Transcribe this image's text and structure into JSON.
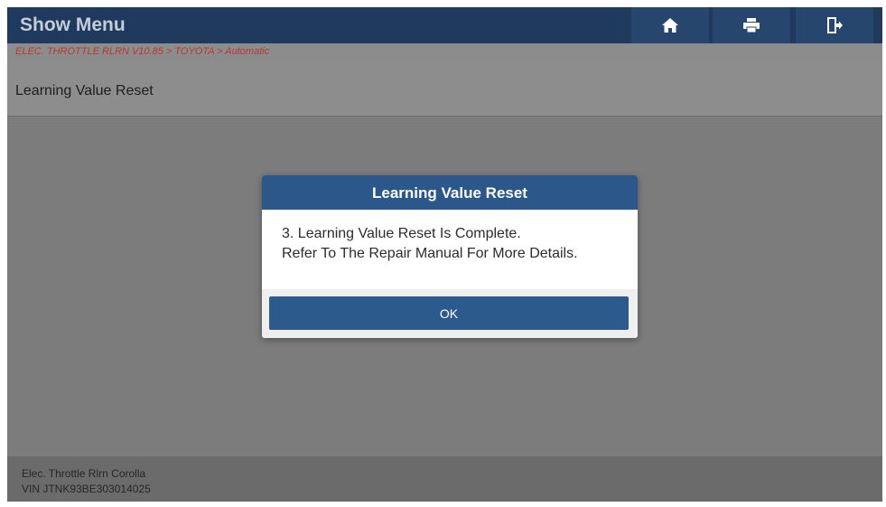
{
  "header": {
    "title": "Show Menu",
    "buttons": [
      {
        "icon": "home-icon"
      },
      {
        "icon": "print-icon"
      },
      {
        "icon": "exit-icon"
      }
    ]
  },
  "breadcrumb": "ELEC. THROTTLE RLRN V10.85 > TOYOTA > Automatic",
  "page_title": "Learning Value Reset",
  "dialog": {
    "title": "Learning Value Reset",
    "message_line1": "3. Learning Value Reset Is Complete.",
    "message_line2": "Refer To The Repair Manual For More Details.",
    "ok_label": "OK"
  },
  "footer": {
    "vehicle": "Elec. Throttle Rlrn Corolla",
    "vin": "VIN JTNK93BE303014025"
  },
  "colors": {
    "header_bg": "#1f3a5c",
    "dialog_accent": "#2b578a",
    "breadcrumb_text": "#b7392f"
  }
}
